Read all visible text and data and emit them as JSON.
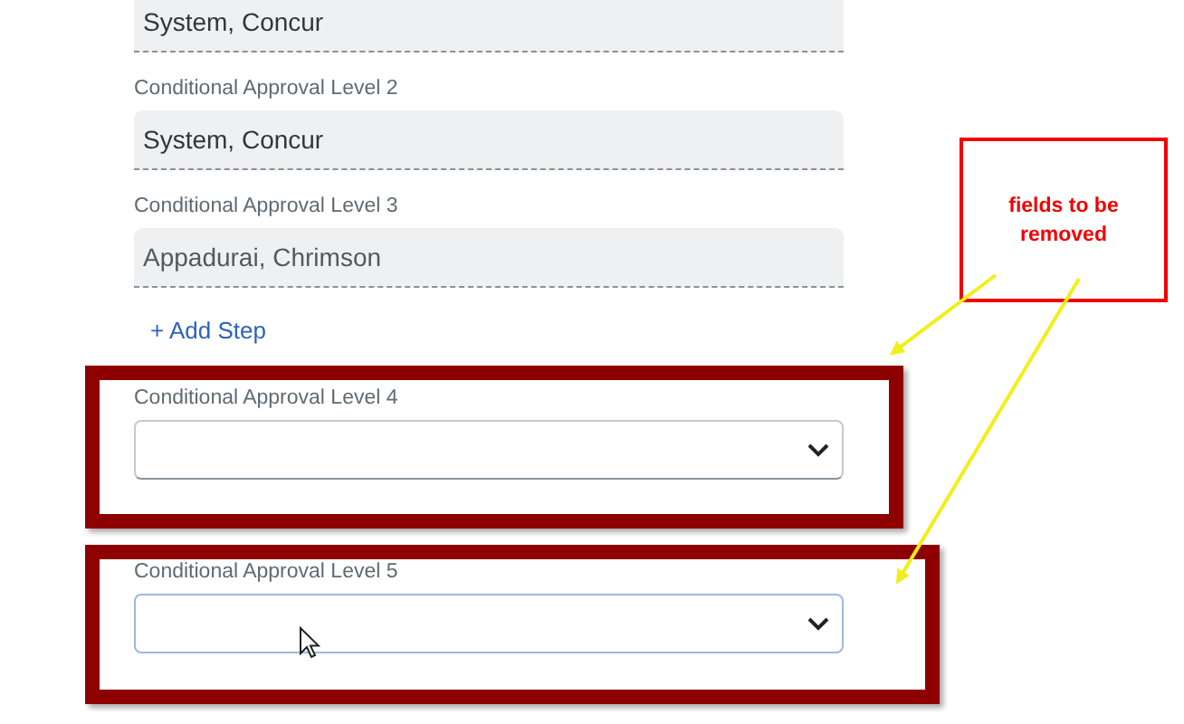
{
  "form": [
    {
      "kind": "readonly",
      "value": "System, Concur"
    },
    {
      "kind": "readonly",
      "label": "Conditional Approval Level 2",
      "value": "System, Concur"
    },
    {
      "kind": "readonly",
      "label": "Conditional Approval Level 3",
      "value": "Appadurai, Chrimson"
    },
    {
      "kind": "add-step",
      "text": "+ Add Step"
    },
    {
      "kind": "dropdown",
      "label": "Conditional Approval Level 4",
      "focused": false
    },
    {
      "kind": "dropdown",
      "label": "Conditional Approval Level 5",
      "focused": true
    }
  ],
  "annotation": {
    "text": "fields to be removed"
  }
}
